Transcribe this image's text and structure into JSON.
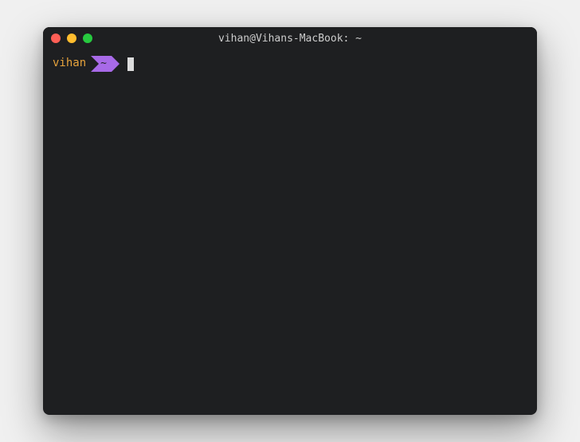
{
  "window": {
    "title": "vihan@Vihans-MacBook: ~"
  },
  "prompt": {
    "user": "vihan",
    "cwd": "~",
    "command": ""
  },
  "colors": {
    "user": "#e6a23c",
    "segment_bg": "#a86ae8",
    "bg": "#1e1f21"
  }
}
